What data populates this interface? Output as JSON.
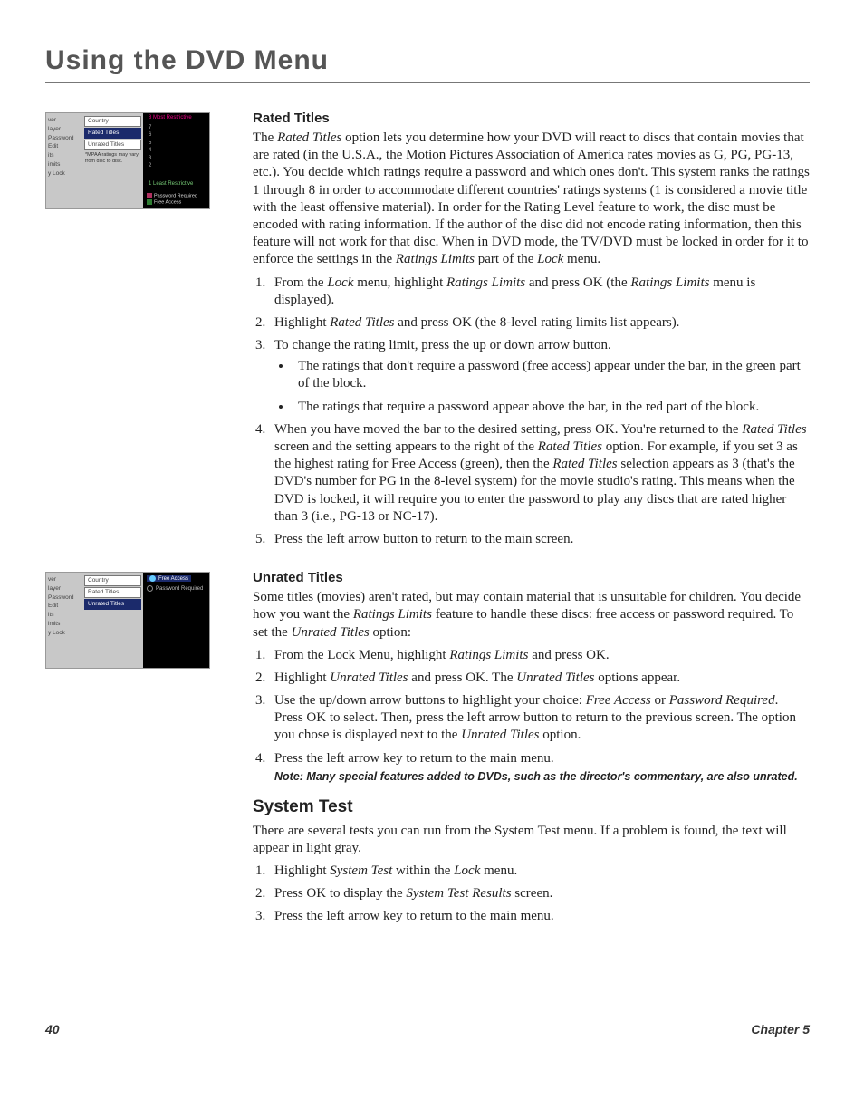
{
  "chapterTitle": "Using the DVD Menu",
  "footer": {
    "page": "40",
    "chapter": "Chapter 5"
  },
  "figure1": {
    "leftMenu": [
      "ver",
      "layer",
      "Password",
      "Edit",
      "its",
      "imits",
      "y Lock"
    ],
    "mid": {
      "country": "Country",
      "rated": "Rated Titles",
      "unrated": "Unrated Titles",
      "mpaa": "*MPAA ratings may vary from disc to disc."
    },
    "right": {
      "top": "8  Most Restrictive",
      "nums": [
        "7",
        "6",
        "5",
        "4",
        "3",
        "2"
      ],
      "bot": "1  Least Restrictive",
      "legPwd": "Password Required",
      "legFree": "Free Access"
    }
  },
  "figure2": {
    "leftMenu": [
      "ver",
      "layer",
      "Password",
      "Edit",
      "its",
      "imits",
      "y Lock"
    ],
    "mid": {
      "country": "Country",
      "rated": "Rated Titles",
      "unrated": "Unrated Titles"
    },
    "right": {
      "optFree": "Free Access",
      "optPwd": "Password Required"
    }
  },
  "rated": {
    "heading": "Rated Titles",
    "intro": {
      "pre": "The ",
      "em1": "Rated Titles",
      "mid1": " option lets you determine how your DVD will react to discs that contain movies that are rated (in the U.S.A., the Motion Pictures Association of America rates movies as G, PG, PG-13, etc.). You decide which ratings require a password and which ones don't. This system ranks the ratings 1 through 8 in order to accommodate different countries' ratings systems (1 is considered a movie title with the least offensive material). In order for the Rating Level feature to work, the disc must be encoded with rating information. If the author of the disc did not encode rating information, then this feature will not work for that disc. When in DVD mode, the TV/DVD must be locked in order for it to enforce the settings in the ",
      "em2": "Ratings Limits",
      "mid2": " part of the ",
      "em3": "Lock",
      "post": " menu."
    },
    "step1": {
      "a": "From the ",
      "em1": "Lock",
      "b": " menu, highlight ",
      "em2": "Ratings Limits",
      "c": " and press OK (the ",
      "em3": "Ratings Limits",
      "d": " menu is displayed)."
    },
    "step2": {
      "a": "Highlight ",
      "em1": "Rated Titles",
      "b": " and press OK (the 8-level rating limits list appears)."
    },
    "step3": "To change the rating limit, press the up or down arrow button.",
    "step3b1": "The ratings that don't require a password (free access) appear under the bar, in the green part of the block.",
    "step3b2": "The ratings that require a password appear above the bar, in the red part of the block.",
    "step4": {
      "a": "When you have moved the bar to the desired setting, press OK. You're returned to the ",
      "em1": "Rated Titles",
      "b": " screen and the setting appears to the right of the ",
      "em2": "Rated Titles",
      "c": " option. For example, if you set 3 as the highest rating for Free Access (green), then the ",
      "em3": "Rated Titles",
      "d": " selection appears as 3 (that's the DVD's number for PG in the 8-level system) for the movie studio's rating. This means when the DVD is locked, it will require you to enter the password to play any discs that are rated higher than 3 (i.e., PG-13 or NC-17)."
    },
    "step5": "Press the left arrow button to return to the main screen."
  },
  "unrated": {
    "heading": "Unrated Titles",
    "intro": {
      "a": "Some titles (movies) aren't rated, but may contain material that is unsuitable for children. You decide how you want the ",
      "em1": "Ratings Limits",
      "b": " feature to handle these discs: free access or password required. To set the ",
      "em2": "Unrated Titles",
      "c": " option:"
    },
    "step1": {
      "a": "From the Lock Menu, highlight ",
      "em1": "Ratings Limits",
      "b": " and press OK."
    },
    "step2": {
      "a": "Highlight ",
      "em1": "Unrated Titles",
      "b": " and press OK. The ",
      "em2": "Unrated Titles",
      "c": " options appear."
    },
    "step3": {
      "a": "Use the up/down arrow buttons to highlight your choice: ",
      "em1": "Free Access",
      "b": " or ",
      "em2": "Password Required",
      "c": ". Press OK to select. Then, press the left arrow button to return to the previous screen. The option you chose is displayed next to the ",
      "em3": "Unrated Titles",
      "d": " option."
    },
    "step4": "Press the left arrow key to return to the main menu.",
    "note": "Note: Many special features added to DVDs, such as the director's commentary, are also unrated."
  },
  "systemTest": {
    "heading": "System Test",
    "intro": "There are several tests you can run from the System Test menu. If a problem is found, the text will appear in light gray.",
    "step1": {
      "a": "Highlight ",
      "em1": "System Test",
      "b": " within the ",
      "em2": "Lock",
      "c": " menu."
    },
    "step2": {
      "a": "Press OK to display the ",
      "em1": "System Test Results",
      "b": " screen."
    },
    "step3": "Press the left arrow key to return to the main menu."
  }
}
